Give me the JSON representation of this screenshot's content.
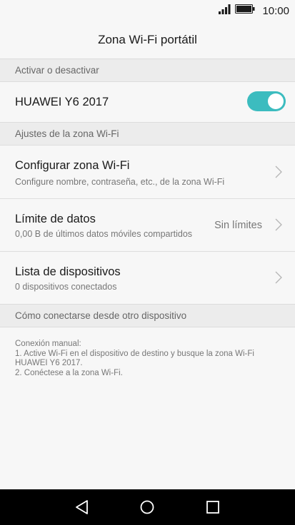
{
  "status_bar": {
    "time": "10:00",
    "signal_icon": "signal-bars-icon",
    "battery_icon": "battery-icon"
  },
  "header": {
    "title": "Zona Wi-Fi portátil"
  },
  "sections": {
    "activate": {
      "header": "Activar o desactivar",
      "device_name": "HUAWEI Y6 2017",
      "toggle_on": true
    },
    "settings": {
      "header": "Ajustes de la zona Wi-Fi",
      "configure": {
        "title": "Configurar zona Wi-Fi",
        "subtitle": "Configure nombre, contraseña, etc., de la zona Wi-Fi"
      },
      "data_limit": {
        "title": "Límite de datos",
        "subtitle": "0,00 B de últimos datos móviles compartidos",
        "value": "Sin límites"
      },
      "devices": {
        "title": "Lista de dispositivos",
        "subtitle": "0 dispositivos conectados"
      }
    },
    "connect": {
      "header": "Cómo conectarse desde otro dispositivo",
      "lines": [
        "Conexión manual:",
        "1. Active Wi-Fi en el dispositivo de destino y busque la zona Wi-Fi",
        "HUAWEI Y6 2017.",
        "2. Conéctese a la zona Wi-Fi."
      ]
    }
  },
  "nav": {
    "back_icon": "back-triangle-icon",
    "home_icon": "home-circle-icon",
    "recents_icon": "recents-square-icon"
  },
  "colors": {
    "accent": "#3cbcbf",
    "background": "#f7f7f7",
    "section_header_bg": "#ececec",
    "nav_bar": "#000000"
  }
}
